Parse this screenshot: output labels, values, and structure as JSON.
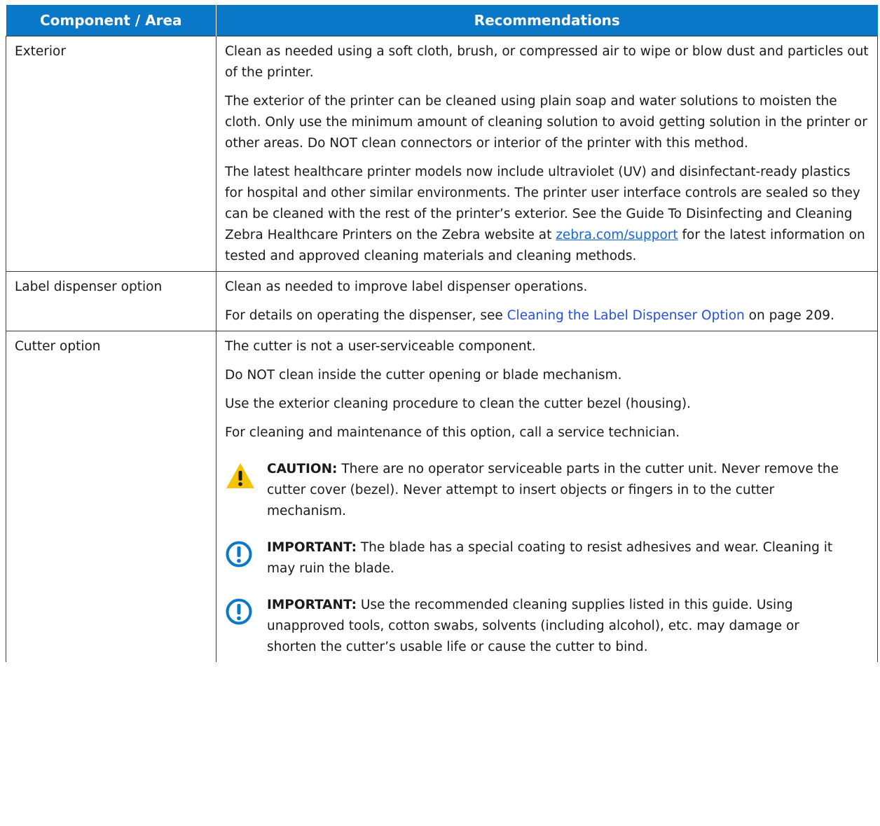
{
  "headers": {
    "component": "Component / Area",
    "recommendations": "Recommendations"
  },
  "rows": [
    {
      "component": "Exterior",
      "p1": "Clean as needed using a soft cloth, brush, or compressed air to wipe or blow dust and particles out of the printer.",
      "p2": "The exterior of the printer can be cleaned using plain soap and water solutions to moisten the cloth. Only use the minimum amount of cleaning solution to avoid getting solution in the printer or other areas. Do NOT clean connectors or interior of the printer with this method.",
      "p3_pre": "The latest healthcare printer models now include ultraviolet (UV) and disinfectant-ready plastics for hospital and other similar environments. The printer user interface controls are sealed so they can be cleaned with the rest of the printer’s exterior. See the Guide To Disinfecting and Cleaning Zebra Healthcare Printers on the Zebra website at ",
      "p3_link": "zebra.com/support",
      "p3_post": " for the latest information on tested and approved cleaning materials and cleaning methods."
    },
    {
      "component": "Label dispenser option",
      "p1": "Clean as needed to improve label dispenser operations.",
      "p2_pre": "For details on operating the dispenser, see ",
      "p2_link": "Cleaning the Label Dispenser Option",
      "p2_post": " on page 209."
    },
    {
      "component": "Cutter option",
      "p1": "The cutter is not a user-serviceable component.",
      "p2": "Do NOT clean inside the cutter opening or blade mechanism.",
      "p3": "Use the exterior cleaning procedure to clean the cutter bezel (housing).",
      "p4": "For cleaning and maintenance of this option, call a service technician.",
      "caution_label": "CAUTION:",
      "caution_text": " There are no operator serviceable parts in the cutter unit. Never remove the cutter cover (bezel). Never attempt to insert objects or fingers in to the cutter mechanism.",
      "important1_label": "IMPORTANT:",
      "important1_text": " The blade has a special coating to resist adhesives and wear. Cleaning it may ruin the blade.",
      "important2_label": "IMPORTANT:",
      "important2_text": " Use the recommended cleaning supplies listed in this guide. Using unapproved tools, cotton swabs, solvents (including alcohol), etc. may damage or shorten the cutter’s usable life or cause the cutter to bind."
    }
  ],
  "icons": {
    "caution": "warning-triangle-icon",
    "important": "exclamation-circle-icon"
  },
  "colors": {
    "header_bg": "#0a78c8",
    "link": "#1565d8",
    "caution": "#f5c400",
    "important": "#0a78c8"
  }
}
